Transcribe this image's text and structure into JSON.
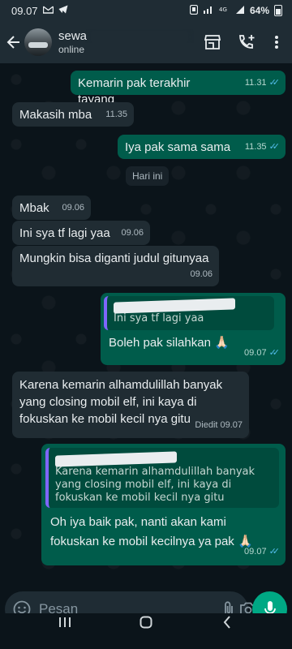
{
  "status_bar": {
    "time": "09.07",
    "battery": "64%"
  },
  "header": {
    "contact_name": "sewa",
    "contact_status": "online"
  },
  "chat": {
    "date_chip": "Hari ini",
    "messages": [
      {
        "text": "Kemarin pak terakhir tayang",
        "time": "11.31"
      },
      {
        "text": "Makasih mba",
        "time": "11.35"
      },
      {
        "text": "Iya pak sama sama",
        "time": "11.35"
      },
      {
        "text": "Mbak",
        "time": "09.06"
      },
      {
        "text": "Ini sya tf lagi yaa",
        "time": "09.06"
      },
      {
        "text": "Mungkin bisa diganti judul gitunyaa",
        "time": "09.06"
      },
      {
        "quote": "Ini sya tf lagi yaa",
        "text": "Boleh pak silahkan 🙏🏻",
        "time": "09.07"
      },
      {
        "text": "Karena kemarin alhamdulillah banyak yang closing mobil elf, ini kaya di fokuskan ke mobil kecil nya gitu",
        "edited_label": "Diedit",
        "time": "09.07"
      },
      {
        "quote": "Karena kemarin alhamdulillah banyak yang closing mobil elf, ini kaya di fokuskan ke mobil kecil nya gitu",
        "text": "Oh iya baik pak, nanti akan kami fokuskan ke mobil kecilnya ya pak 🙏🏻",
        "time": "09.07"
      }
    ]
  },
  "composer": {
    "placeholder": "Pesan"
  },
  "colors": {
    "outgoing_bubble": "#005c4b",
    "incoming_bubble": "#202c33",
    "accent": "#00a884",
    "read_ticks": "#53bdeb"
  },
  "icons": [
    "back-arrow-icon",
    "store-icon",
    "add-call-icon",
    "more-vert-icon",
    "emoji-icon",
    "attach-icon",
    "camera-icon",
    "mic-icon"
  ]
}
